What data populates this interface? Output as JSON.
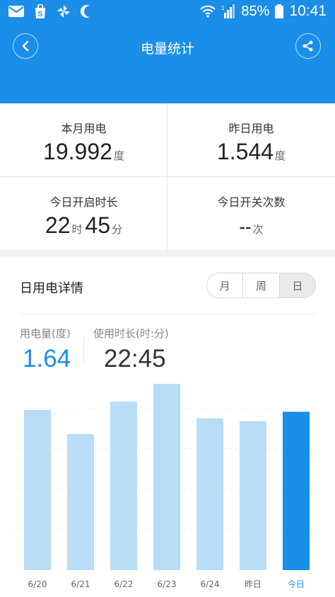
{
  "status_bar": {
    "battery": "85%",
    "time": "10:41",
    "signal_label": "1"
  },
  "header": {
    "title": "电量统计",
    "back_icon": "chevron-left-icon",
    "share_icon": "share-icon"
  },
  "stats": {
    "month": {
      "label": "本月用电",
      "value": "19.992",
      "unit": "度"
    },
    "yesterday": {
      "label": "昨日用电",
      "value": "1.544",
      "unit": "度"
    },
    "today_on": {
      "label": "今日开启时长",
      "hours": "22",
      "hours_unit": "时",
      "minutes": "45",
      "minutes_unit": "分"
    },
    "switch_count": {
      "label": "今日开关次数",
      "value": "--",
      "unit": "次"
    }
  },
  "detail": {
    "title": "日用电详情",
    "tabs": [
      "月",
      "周",
      "日"
    ],
    "active_tab": "日",
    "usage_label": "用电量(度)",
    "usage_value": "1.64",
    "duration_label": "使用时长(时:分)",
    "duration_value": "22:45"
  },
  "colors": {
    "primary": "#1b8ee8",
    "bar_light": "#b9dcf7",
    "bar_active": "#1b8ee8"
  },
  "chart_data": {
    "type": "bar",
    "categories": [
      "6/20",
      "6/21",
      "6/22",
      "6/23",
      "6/24",
      "昨日",
      "今日"
    ],
    "values": [
      1.72,
      1.46,
      1.81,
      2.0,
      1.63,
      1.6,
      1.7
    ],
    "highlight_index": 6,
    "ylim": [
      0,
      2.0
    ],
    "grid": true
  }
}
